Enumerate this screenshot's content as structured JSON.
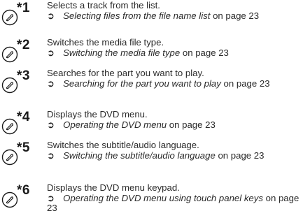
{
  "items": [
    {
      "number": "*1",
      "description": "Selects a track from the list.",
      "arrow": "➲",
      "ref_title": "Selecting files from the file name list",
      "ref_suffix": " on page 23"
    },
    {
      "number": "*2",
      "description": "Switches the media file type.",
      "arrow": "➲",
      "ref_title": "Switching the media file type",
      "ref_suffix": " on page 23"
    },
    {
      "number": "*3",
      "description": "Searches for the part you want to play.",
      "arrow": "➲",
      "ref_title": "Searching for the part you want to play",
      "ref_suffix": " on page 23"
    },
    {
      "number": "*4",
      "description": "Displays the DVD menu.",
      "arrow": "➲",
      "ref_title": "Operating the DVD menu",
      "ref_suffix": " on page 23"
    },
    {
      "number": "*5",
      "description": "Switches the subtitle/audio language.",
      "arrow": "➲",
      "ref_title": "Switching the subtitle/audio language",
      "ref_suffix": " on page 23"
    },
    {
      "number": "*6",
      "description": "Displays the DVD menu keypad.",
      "arrow": "➲",
      "ref_title": "Operating the DVD menu using touch panel keys",
      "ref_suffix": " on page 23"
    }
  ]
}
